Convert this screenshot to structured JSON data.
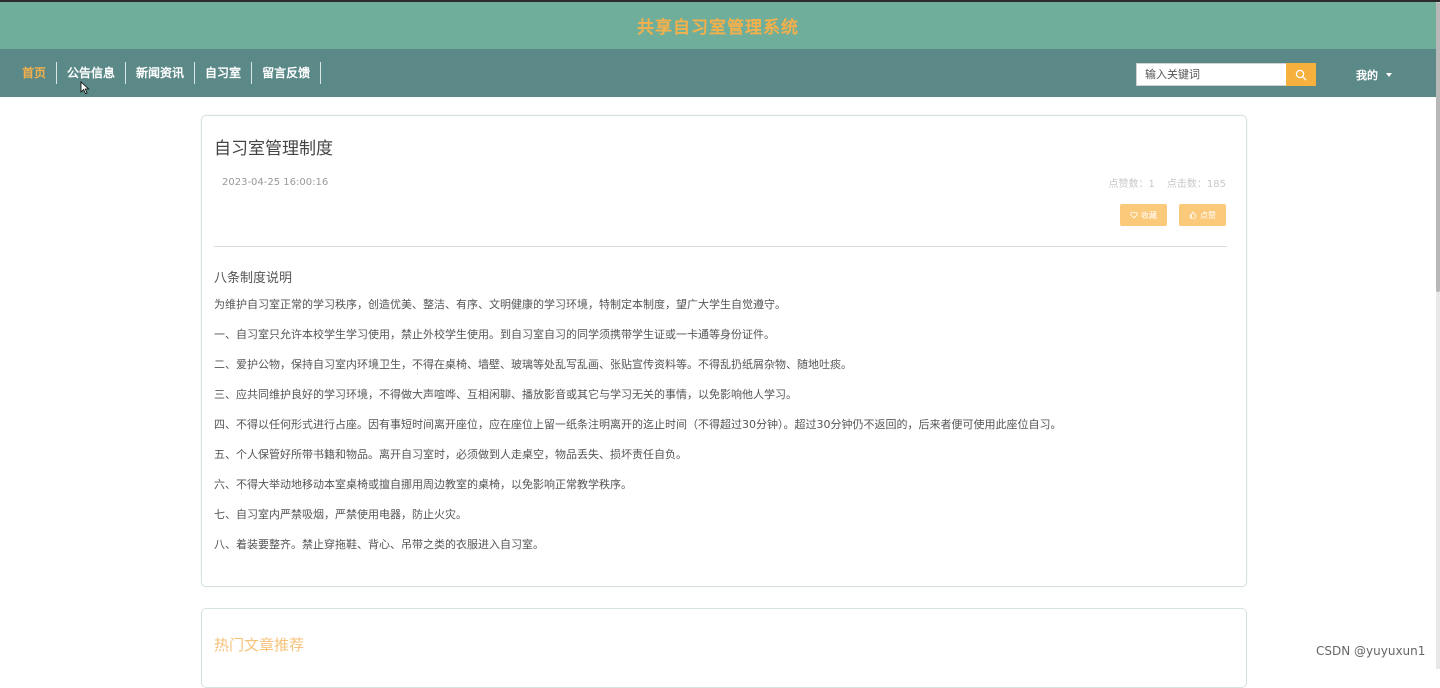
{
  "header": {
    "site_title": "共享自习室管理系统"
  },
  "nav": {
    "items": [
      {
        "label": "首页"
      },
      {
        "label": "公告信息"
      },
      {
        "label": "新闻资讯"
      },
      {
        "label": "自习室"
      },
      {
        "label": "留言反馈"
      }
    ],
    "search_placeholder": "输入关键词",
    "my_label": "我的"
  },
  "article": {
    "title": "自习室管理制度",
    "date": "2023-04-25 16:00:16",
    "likes_label": "点赞数：1",
    "clicks_label": "点击数：185",
    "collect_label": "收藏",
    "like_label": "点赞",
    "section_heading": "八条制度说明",
    "lines": [
      "为维护自习室正常的学习秩序，创造优美、整洁、有序、文明健康的学习环境，特制定本制度，望广大学生自觉遵守。",
      "一、自习室只允许本校学生学习使用，禁止外校学生使用。到自习室自习的同学须携带学生证或一卡通等身份证件。",
      "二、爱护公物，保持自习室内环境卫生，不得在桌椅、墙壁、玻璃等处乱写乱画、张贴宣传资料等。不得乱扔纸屑杂物、随地吐痰。",
      "三、应共同维护良好的学习环境，不得做大声喧哗、互相闲聊、播放影音或其它与学习无关的事情，以免影响他人学习。",
      "四、不得以任何形式进行占座。因有事短时间离开座位，应在座位上留一纸条注明离开的迄止时间（不得超过30分钟）。超过30分钟仍不返回的，后来者便可使用此座位自习。",
      "五、个人保管好所带书籍和物品。离开自习室时，必须做到人走桌空，物品丢失、损坏责任自负。",
      "六、不得大举动地移动本室桌椅或擅自挪用周边教室的桌椅，以免影响正常教学秩序。",
      "七、自习室内严禁吸烟，严禁使用电器，防止火灾。",
      "八、着装要整齐。禁止穿拖鞋、背心、吊带之类的衣服进入自习室。"
    ]
  },
  "hot": {
    "title": "热门文章推荐"
  },
  "watermark": "CSDN @yuyuxun1",
  "colors": {
    "title_bar": "#6fae9a",
    "nav_bar": "#5b8987",
    "accent": "#f3b04b",
    "button": "#fbc97a"
  }
}
